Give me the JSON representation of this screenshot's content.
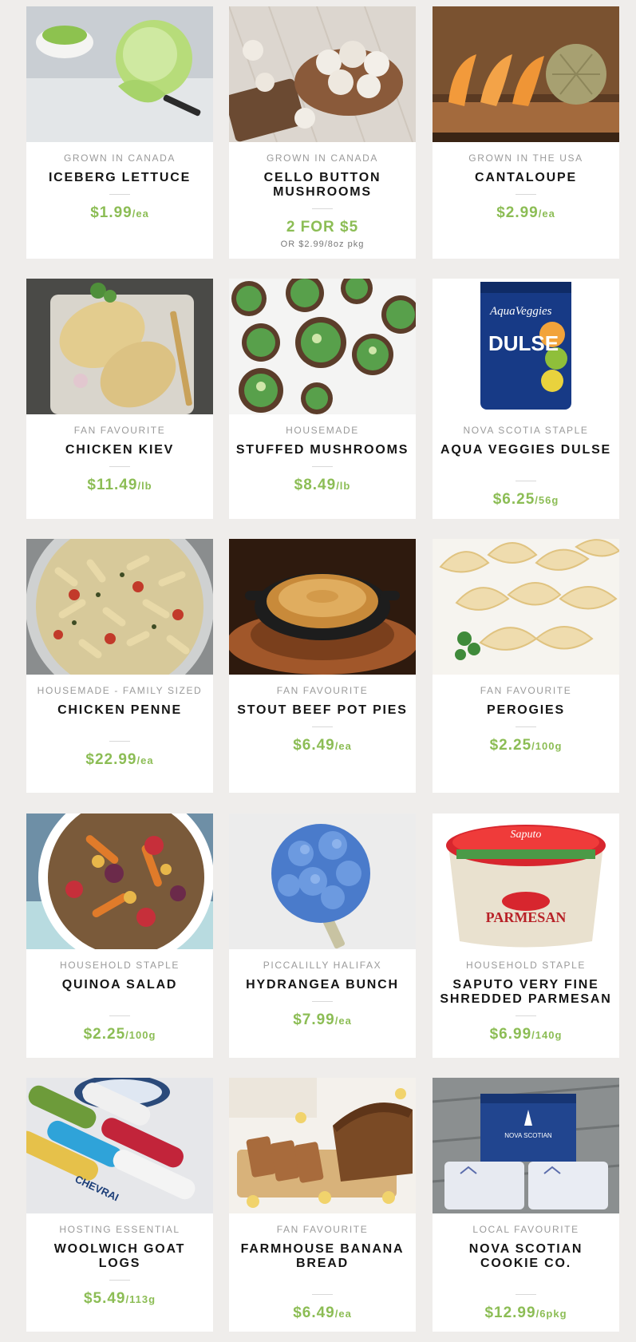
{
  "products": [
    {
      "origin": "GROWN IN CANADA",
      "name": "ICEBERG LETTUCE",
      "price": "$1.99",
      "unit": "/ea",
      "image_icon": "iceberg-lettuce-photo"
    },
    {
      "origin": "GROWN IN CANADA",
      "name": "CELLO BUTTON MUSHROOMS",
      "price": "2 FOR $5",
      "unit": "",
      "sub": "OR $2.99/8oz pkg",
      "image_icon": "button-mushrooms-photo"
    },
    {
      "origin": "GROWN IN THE USA",
      "name": "CANTALOUPE",
      "price": "$2.99",
      "unit": "/ea",
      "image_icon": "cantaloupe-photo"
    },
    {
      "origin": "FAN FAVOURITE",
      "name": "CHICKEN KIEV",
      "price": "$11.49",
      "unit": "/lb",
      "image_icon": "chicken-kiev-photo"
    },
    {
      "origin": "HOUSEMADE",
      "name": "STUFFED MUSHROOMS",
      "price": "$8.49",
      "unit": "/lb",
      "image_icon": "stuffed-mushrooms-photo"
    },
    {
      "origin": "NOVA SCOTIA STAPLE",
      "name": "AQUA VEGGIES DULSE",
      "price": "$6.25",
      "unit": "/56g",
      "image_icon": "dulse-bag-photo",
      "package_text": {
        "brand": "AquaVeggies",
        "product": "DULSE"
      }
    },
    {
      "origin": "HOUSEMADE - FAMILY SIZED",
      "name": "CHICKEN PENNE",
      "price": "$22.99",
      "unit": "/ea",
      "image_icon": "chicken-penne-photo"
    },
    {
      "origin": "FAN FAVOURITE",
      "name": "STOUT BEEF POT PIES",
      "price": "$6.49",
      "unit": "/ea",
      "image_icon": "pot-pie-photo"
    },
    {
      "origin": "FAN FAVOURITE",
      "name": "PEROGIES",
      "price": "$2.25",
      "unit": "/100g",
      "image_icon": "perogies-photo"
    },
    {
      "origin": "HOUSEHOLD STAPLE",
      "name": "QUINOA SALAD",
      "price": "$2.25",
      "unit": "/100g",
      "image_icon": "quinoa-salad-photo"
    },
    {
      "origin": "PICCALILLY HALIFAX",
      "name": "HYDRANGEA BUNCH",
      "price": "$7.99",
      "unit": "/ea",
      "image_icon": "hydrangea-photo"
    },
    {
      "origin": "HOUSEHOLD STAPLE",
      "name": "SAPUTO VERY FINE SHREDDED PARMESAN",
      "price": "$6.99",
      "unit": "/140g",
      "image_icon": "parmesan-tub-photo",
      "package_text": {
        "brand": "Saputo",
        "product": "PARMESAN"
      }
    },
    {
      "origin": "HOSTING ESSENTIAL",
      "name": "WOOLWICH GOAT LOGS",
      "price": "$5.49",
      "unit": "/113g",
      "image_icon": "goat-cheese-logs-photo",
      "package_text": {
        "brand": "CHEVRAI"
      }
    },
    {
      "origin": "FAN FAVOURITE",
      "name": "FARMHOUSE BANANA BREAD",
      "price": "$6.49",
      "unit": "/ea",
      "image_icon": "banana-bread-photo"
    },
    {
      "origin": "LOCAL FAVOURITE",
      "name": "NOVA SCOTIAN COOKIE CO.",
      "price": "$12.99",
      "unit": "/6pkg",
      "image_icon": "cookie-box-photo",
      "package_text": {
        "brand": "NOVA SCOTIAN"
      }
    }
  ],
  "colors": {
    "price": "#8cbd55",
    "background": "#efedeb",
    "card": "#ffffff",
    "name": "#151515",
    "origin": "#9a9a9a"
  }
}
